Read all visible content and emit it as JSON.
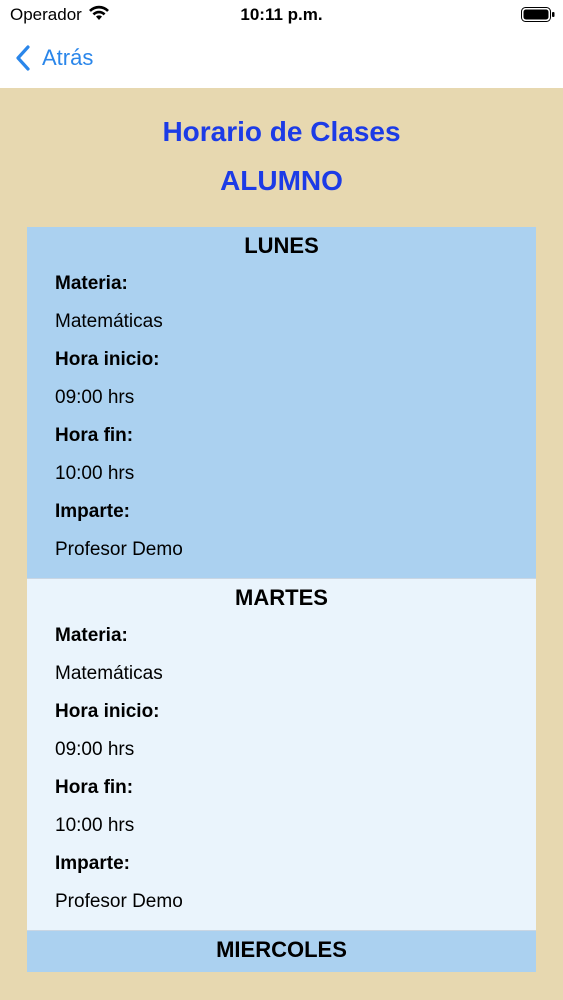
{
  "status_bar": {
    "carrier": "Operador",
    "time": "10:11 p.m."
  },
  "nav": {
    "back_label": "Atrás",
    "accent_color": "#2a86ea"
  },
  "header": {
    "title": "Horario de Clases",
    "subtitle": "ALUMNO",
    "title_color": "#1c3be6"
  },
  "labels": {
    "materia": "Materia:",
    "hora_inicio": "Hora inicio:",
    "hora_fin": "Hora fin:",
    "imparte": "Imparte:"
  },
  "days": [
    {
      "name": "LUNES",
      "materia": "Matemáticas",
      "hora_inicio": "09:00 hrs",
      "hora_fin": "10:00 hrs",
      "imparte": "Profesor Demo"
    },
    {
      "name": "MARTES",
      "materia": "Matemáticas",
      "hora_inicio": "09:00 hrs",
      "hora_fin": "10:00 hrs",
      "imparte": "Profesor Demo"
    },
    {
      "name": "MIERCOLES"
    }
  ]
}
